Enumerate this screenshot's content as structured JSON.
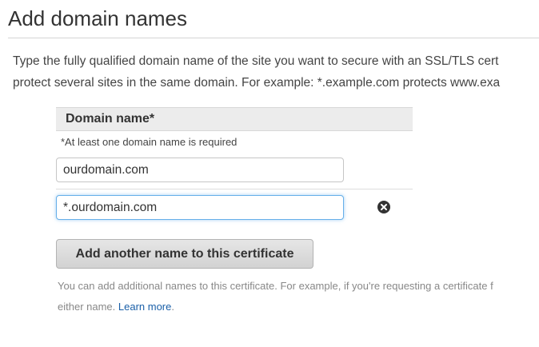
{
  "page": {
    "title": "Add domain names",
    "intro_line1": "Type the fully qualified domain name of the site you want to secure with an SSL/TLS cert",
    "intro_line2": "protect several sites in the same domain. For example: *.example.com protects www.exa"
  },
  "domain_table": {
    "header": "Domain name*",
    "required_note": "*At least one domain name is required",
    "entries": [
      {
        "value": "ourdomain.com"
      },
      {
        "value": "*.ourdomain.com"
      }
    ]
  },
  "actions": {
    "add_label": "Add another name to this certificate",
    "remove_icon": "circle-x-icon"
  },
  "help": {
    "line1": "You can add additional names to this certificate. For example, if you're requesting a certificate f",
    "line2_prefix": "either name. ",
    "learn_more": "Learn more",
    "line2_suffix": "."
  },
  "colors": {
    "focus_border": "#66afe9",
    "link": "#1a5fa8"
  }
}
